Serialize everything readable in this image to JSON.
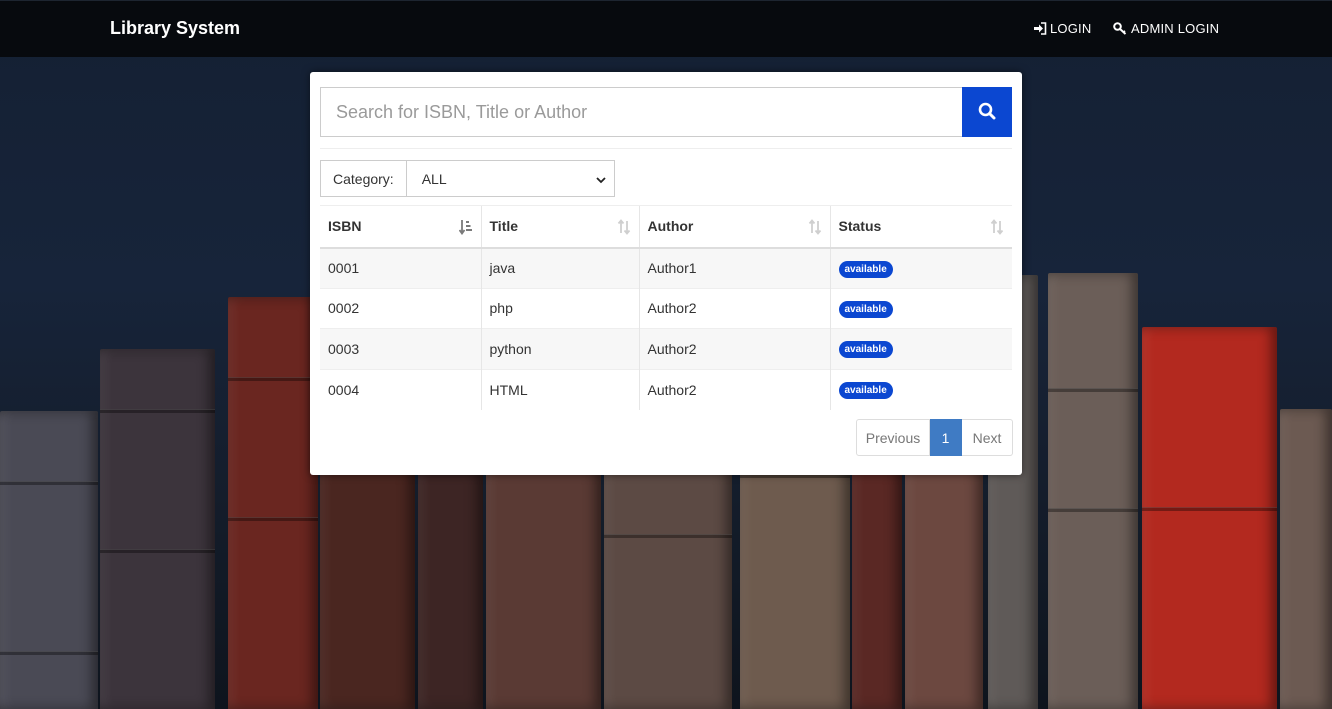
{
  "navbar": {
    "brand": "Library System",
    "login_label": "LOGIN",
    "admin_login_label": "ADMIN LOGIN"
  },
  "search": {
    "placeholder": "Search for ISBN, Title or Author",
    "button_icon": "search-icon"
  },
  "filter": {
    "label": "Category:",
    "selected": "ALL"
  },
  "table": {
    "columns": [
      "ISBN",
      "Title",
      "Author",
      "Status"
    ],
    "rows": [
      {
        "isbn": "0001",
        "title": "java",
        "author": "Author1",
        "status": "available"
      },
      {
        "isbn": "0002",
        "title": "php",
        "author": "Author2",
        "status": "available"
      },
      {
        "isbn": "0003",
        "title": "python",
        "author": "Author2",
        "status": "available"
      },
      {
        "isbn": "0004",
        "title": "HTML",
        "author": "Author2",
        "status": "available"
      }
    ]
  },
  "pagination": {
    "previous": "Previous",
    "current_page": "1",
    "next": "Next"
  },
  "colors": {
    "navbar_bg": "#070a0e",
    "accent": "#0b47d1",
    "active_page": "#3f7bc4"
  }
}
